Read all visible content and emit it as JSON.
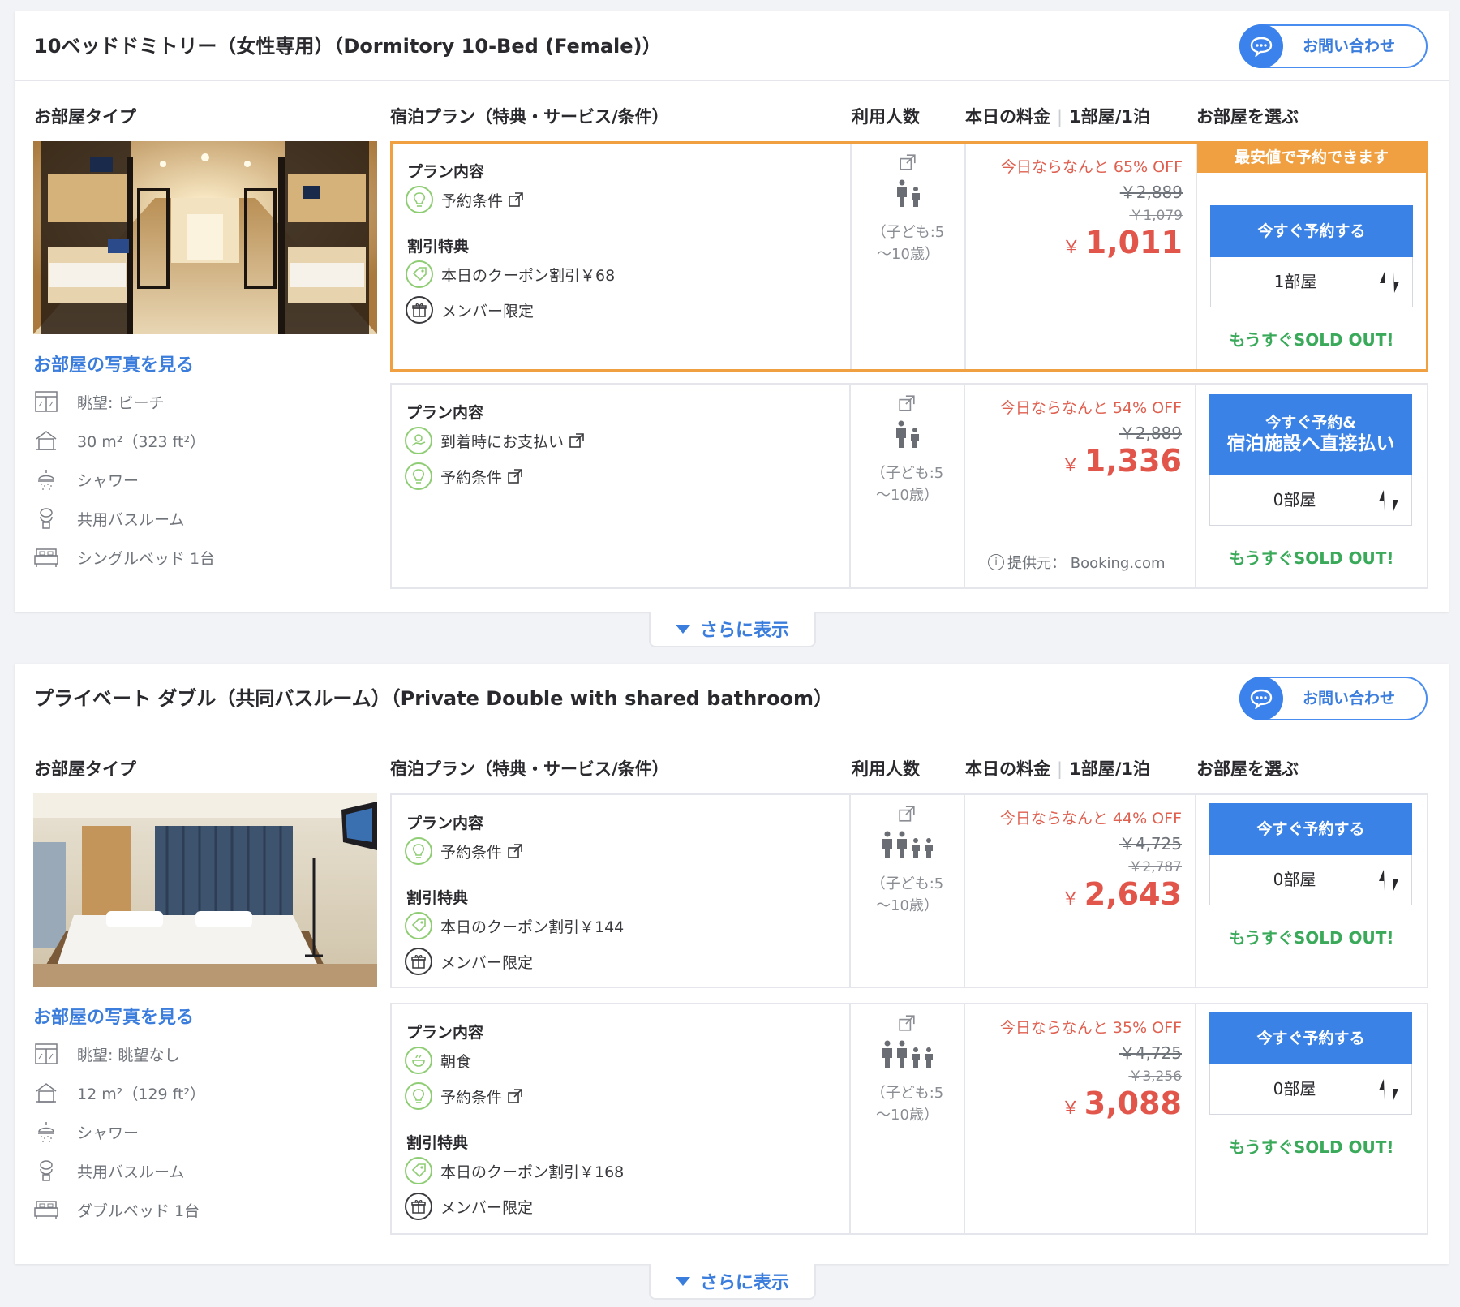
{
  "colors": {
    "accent": "#3a82e6",
    "best": "#f0a040",
    "price": "#e2554a",
    "soldout": "#3aaa5a"
  },
  "rooms": [
    {
      "title": "10ベッドドミトリー（女性専用）（Dormitory 10-Bed (Female)）",
      "contact_label": "お問い合わせ",
      "headers": {
        "room_type": "お部屋タイプ",
        "plan": "宿泊プラン（特典・サービス/条件）",
        "occupancy": "利用人数",
        "price_a": "本日の料金",
        "price_b": "1部屋/1泊",
        "select": "お部屋を選ぶ"
      },
      "photo_link": "お部屋の写真を見る",
      "amenities": [
        {
          "icon": "view-icon",
          "label": "眺望: ビーチ"
        },
        {
          "icon": "area-icon",
          "label": "30 m²（323 ft²）"
        },
        {
          "icon": "shower-icon",
          "label": "シャワー"
        },
        {
          "icon": "toilet-icon",
          "label": "共用バスルーム"
        },
        {
          "icon": "bed-icon",
          "label": "シングルベッド 1台"
        }
      ],
      "plans": [
        {
          "plan_heading": "プラン内容",
          "items": [
            "予約条件"
          ],
          "discount_heading": "割引特典",
          "discounts": [
            "本日のクーポン割引￥68",
            "メンバー限定"
          ],
          "occupancy_note_1": "（子ども:5",
          "occupancy_note_2": "〜10歳）",
          "off_label": "今日ならなんと 65% OFF",
          "strike_1": "￥2,889",
          "strike_2": "￥1,079",
          "yen": "￥",
          "price": "1,011",
          "best_banner": "最安値で予約できます",
          "book_label": "今すぐ予約する",
          "rooms_qty": "1部屋",
          "soldout": "もうすぐSOLD OUT!"
        },
        {
          "plan_heading": "プラン内容",
          "items": [
            "到着時にお支払い",
            "予約条件"
          ],
          "occupancy_note_1": "（子ども:5",
          "occupancy_note_2": "〜10歳）",
          "off_label": "今日ならなんと 54% OFF",
          "strike_1": "￥2,889",
          "yen": "￥",
          "price": "1,336",
          "provider": "提供元： Booking.com",
          "book_label_1": "今すぐ予約&",
          "book_label_2": "宿泊施設へ直接払い",
          "rooms_qty": "0部屋",
          "soldout": "もうすぐSOLD OUT!"
        }
      ],
      "more_label": "さらに表示"
    },
    {
      "title": "プライベート ダブル（共同バスルーム）（Private Double with shared bathroom）",
      "contact_label": "お問い合わせ",
      "headers": {
        "room_type": "お部屋タイプ",
        "plan": "宿泊プラン（特典・サービス/条件）",
        "occupancy": "利用人数",
        "price_a": "本日の料金",
        "price_b": "1部屋/1泊",
        "select": "お部屋を選ぶ"
      },
      "photo_link": "お部屋の写真を見る",
      "amenities": [
        {
          "icon": "view-icon",
          "label": "眺望: 眺望なし"
        },
        {
          "icon": "area-icon",
          "label": "12 m²（129 ft²）"
        },
        {
          "icon": "shower-icon",
          "label": "シャワー"
        },
        {
          "icon": "toilet-icon",
          "label": "共用バスルーム"
        },
        {
          "icon": "bed-icon",
          "label": "ダブルベッド 1台"
        }
      ],
      "plans": [
        {
          "plan_heading": "プラン内容",
          "items": [
            "予約条件"
          ],
          "discount_heading": "割引特典",
          "discounts": [
            "本日のクーポン割引￥144",
            "メンバー限定"
          ],
          "occupancy_note_1": "（子ども:5",
          "occupancy_note_2": "〜10歳）",
          "off_label": "今日ならなんと 44% OFF",
          "strike_1": "￥4,725",
          "strike_2": "￥2,787",
          "yen": "￥",
          "price": "2,643",
          "book_label": "今すぐ予約する",
          "rooms_qty": "0部屋",
          "soldout": "もうすぐSOLD OUT!"
        },
        {
          "plan_heading": "プラン内容",
          "items": [
            "朝食",
            "予約条件"
          ],
          "discount_heading": "割引特典",
          "discounts": [
            "本日のクーポン割引￥168",
            "メンバー限定"
          ],
          "occupancy_note_1": "（子ども:5",
          "occupancy_note_2": "〜10歳）",
          "off_label": "今日ならなんと 35% OFF",
          "strike_1": "￥4,725",
          "strike_2": "￥3,256",
          "yen": "￥",
          "price": "3,088",
          "book_label": "今すぐ予約する",
          "rooms_qty": "0部屋",
          "soldout": "もうすぐSOLD OUT!"
        }
      ],
      "more_label": "さらに表示"
    }
  ]
}
